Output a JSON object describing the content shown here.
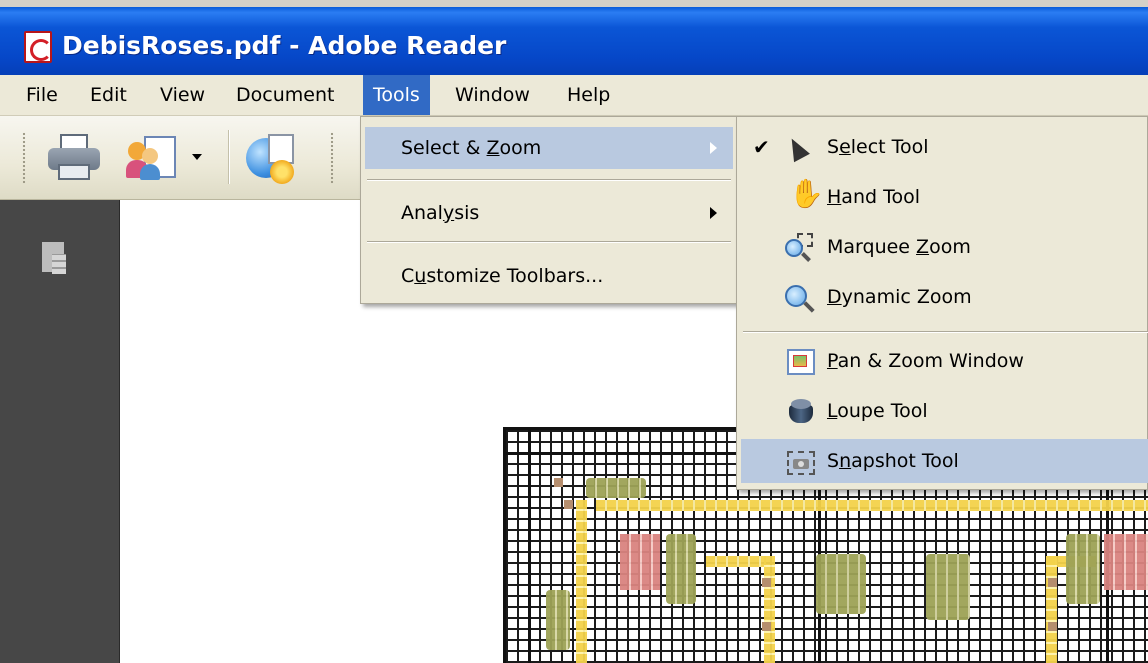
{
  "window": {
    "title": "DebisRoses.pdf - Adobe Reader",
    "icon": "pdf-file-icon"
  },
  "menubar": {
    "items": [
      "File",
      "Edit",
      "View",
      "Document",
      "Tools",
      "Window",
      "Help"
    ],
    "active": "Tools"
  },
  "toolbar": {
    "icons": [
      "print-icon",
      "collaborate-icon",
      "dropdown-arrow-icon",
      "review-icon"
    ]
  },
  "navpane": {
    "icons": [
      "pages-icon"
    ]
  },
  "tools_menu": {
    "items": [
      {
        "label_pre": "Select & ",
        "label_u": "Z",
        "label_post": "oom",
        "submenu": true,
        "highlighted": true
      },
      {
        "label_pre": "Anal",
        "label_u": "y",
        "label_post": "sis",
        "submenu": true,
        "highlighted": false
      },
      {
        "label_pre": "C",
        "label_u": "u",
        "label_post": "stomize Toolbars...",
        "submenu": false,
        "highlighted": false
      }
    ]
  },
  "zoom_submenu": {
    "items": [
      {
        "label_pre": "S",
        "label_u": "e",
        "label_post": "lect Tool",
        "checked": true,
        "icon": "select-arrow-icon"
      },
      {
        "label_pre": "",
        "label_u": "H",
        "label_post": "and Tool",
        "checked": false,
        "icon": "hand-icon"
      },
      {
        "label_pre": "Marquee ",
        "label_u": "Z",
        "label_post": "oom",
        "checked": false,
        "icon": "marquee-zoom-icon"
      },
      {
        "label_pre": "",
        "label_u": "D",
        "label_post": "ynamic Zoom",
        "checked": false,
        "icon": "dynamic-zoom-icon"
      },
      {
        "label_pre": "",
        "label_u": "P",
        "label_post": "an & Zoom Window",
        "checked": false,
        "icon": "pan-zoom-window-icon"
      },
      {
        "label_pre": "",
        "label_u": "L",
        "label_post": "oupe Tool",
        "checked": false,
        "icon": "loupe-icon"
      },
      {
        "label_pre": "S",
        "label_u": "n",
        "label_post": "apshot Tool",
        "checked": false,
        "icon": "snapshot-icon",
        "highlighted": true
      }
    ],
    "check_glyph": "✔"
  },
  "colors": {
    "titlebar": "#0647c8",
    "menu_highlight": "#316ac5",
    "submenu_highlight": "#b9c9e0",
    "menu_bg": "#ece9d8",
    "navpane_bg": "#474747"
  }
}
